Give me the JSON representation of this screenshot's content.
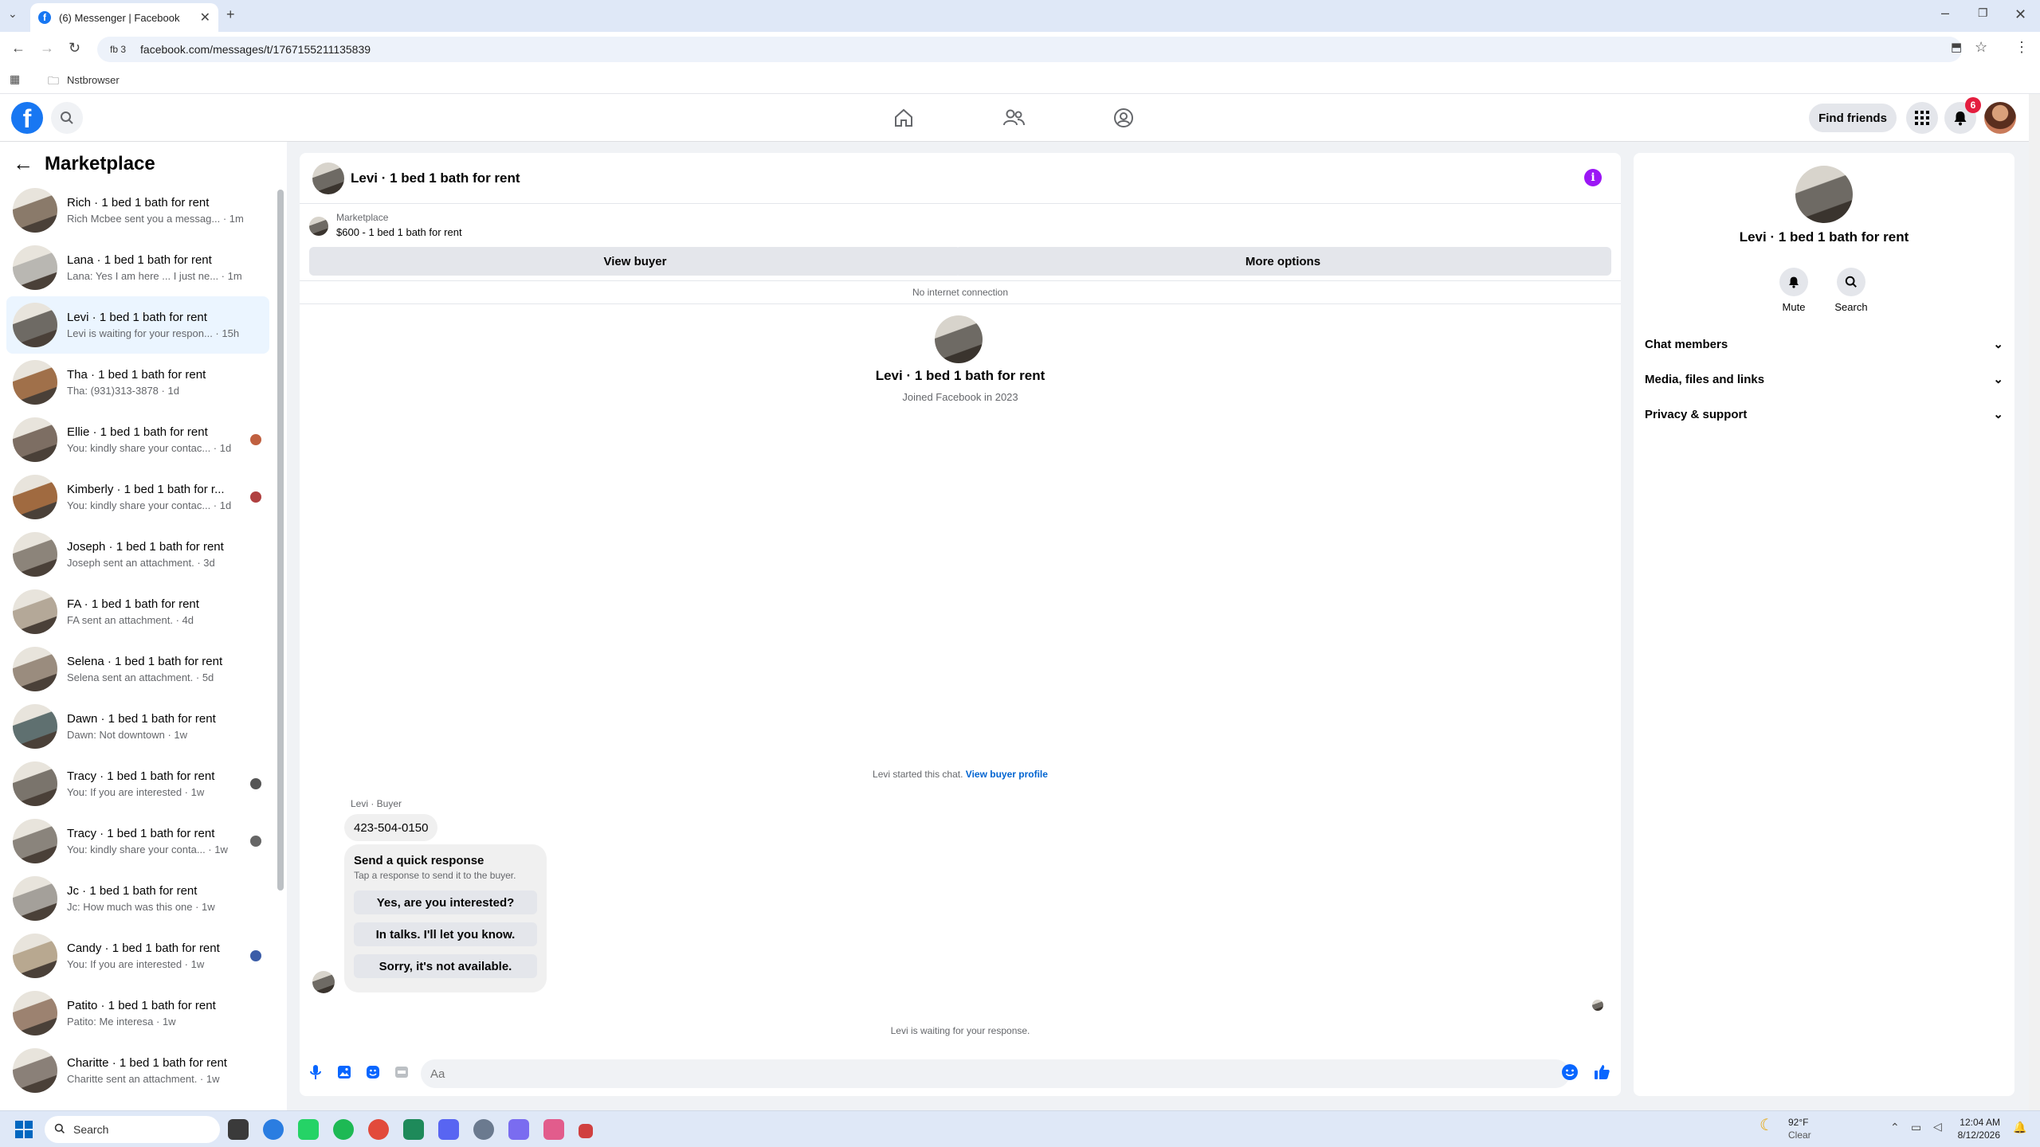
{
  "browser": {
    "tab_title": "(6) Messenger | Facebook",
    "profile_pill": "fb 3",
    "url": "facebook.com/messages/t/1767155211135839",
    "bookmark": "Nstbrowser"
  },
  "header": {
    "find_friends": "Find friends",
    "notification_count": "6"
  },
  "sidebar": {
    "title": "Marketplace",
    "conversations": [
      {
        "name": "Rich · 1 bed 1 bath for rent",
        "preview": "Rich Mcbee sent you a messag... · 1m",
        "color": "#8a7a6a"
      },
      {
        "name": "Lana · 1 bed 1 bath for rent",
        "preview": "Lana: Yes I am here ... I just ne... · 1m",
        "color": "#b9b7b2"
      },
      {
        "name": "Levi · 1 bed 1 bath for rent",
        "preview": "Levi is waiting for your respon... · 15h",
        "color": "#6e6a64"
      },
      {
        "name": "Tha · 1 bed 1 bath for rent",
        "preview": "Tha: (931)313-3878 · 1d",
        "color": "#a0704a"
      },
      {
        "name": "Ellie · 1 bed 1 bath for rent",
        "preview": "You: kindly share your contac... · 1d",
        "color": "#7d6e63"
      },
      {
        "name": "Kimberly · 1 bed 1 bath for r...",
        "preview": "You: kindly share your contac... · 1d",
        "color": "#a06a40"
      },
      {
        "name": "Joseph · 1 bed 1 bath for rent",
        "preview": "Joseph sent an attachment. · 3d",
        "color": "#8c847a"
      },
      {
        "name": "FA · 1 bed 1 bath for rent",
        "preview": "FA sent an attachment. · 4d",
        "color": "#b4a898"
      },
      {
        "name": "Selena · 1 bed 1 bath for rent",
        "preview": "Selena sent an attachment. · 5d",
        "color": "#9a8c7e"
      },
      {
        "name": "Dawn · 1 bed 1 bath for rent",
        "preview": "Dawn: Not downtown · 1w",
        "color": "#5f7070"
      },
      {
        "name": "Tracy · 1 bed 1 bath for rent",
        "preview": "You: If you are interested · 1w",
        "color": "#7a746c"
      },
      {
        "name": "Tracy · 1 bed 1 bath for rent",
        "preview": "You: kindly share your conta... · 1w",
        "color": "#8a847c"
      },
      {
        "name": "Jc · 1 bed 1 bath for rent",
        "preview": "Jc: How much was this one · 1w",
        "color": "#a4a09a"
      },
      {
        "name": "Candy · 1 bed 1 bath for rent",
        "preview": "You: If you are interested · 1w",
        "color": "#b8a890"
      },
      {
        "name": "Patito · 1 bed 1 bath for rent",
        "preview": "Patito: Me interesa · 1w",
        "color": "#9c8270"
      },
      {
        "name": "Charitte · 1 bed 1 bath for rent",
        "preview": "Charitte sent an attachment. · 1w",
        "color": "#8a8078"
      }
    ]
  },
  "chat": {
    "title": "Levi · 1 bed 1 bath for rent",
    "marketplace_label": "Marketplace",
    "listing": "$600 - 1 bed 1 bath for rent",
    "view_buyer": "View buyer",
    "more_options": "More options",
    "no_internet": "No internet connection",
    "intro_name": "Levi · 1 bed 1 bath for rent",
    "intro_joined": "Joined Facebook in 2023",
    "started_text": "Levi started this chat.",
    "view_buyer_profile": "View buyer profile",
    "sender_meta": "Levi · Buyer",
    "phone_message": "423-504-0150",
    "quick_title": "Send a quick response",
    "quick_sub": "Tap a response to send it to the buyer.",
    "quick_replies": [
      "Yes, are you interested?",
      "In talks. I'll let you know.",
      "Sorry, it's not available."
    ],
    "waiting": "Levi is waiting for your response.",
    "input_placeholder": "Aa"
  },
  "right_panel": {
    "name": "Levi · 1 bed 1 bath for rent",
    "mute": "Mute",
    "search": "Search",
    "sections": [
      "Chat members",
      "Media, files and links",
      "Privacy & support"
    ]
  },
  "taskbar": {
    "search": "Search",
    "temperature": "92°F",
    "condition": "Clear",
    "time": "12:04 AM",
    "date": "8/12/2026"
  }
}
